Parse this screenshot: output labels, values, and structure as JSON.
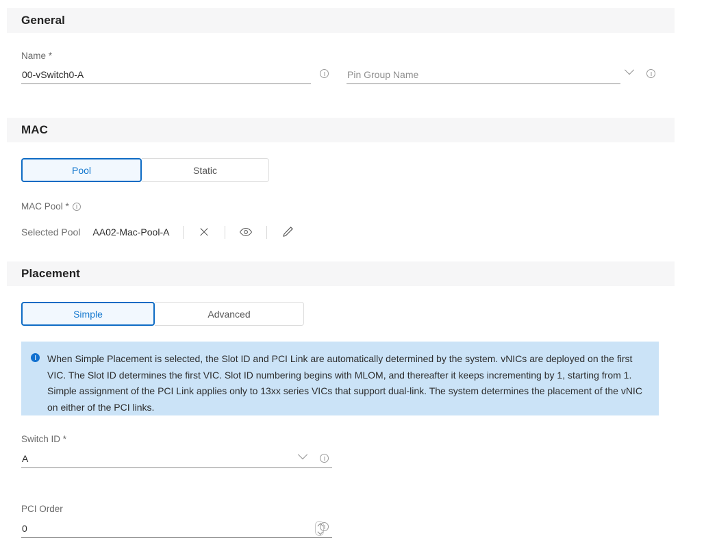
{
  "sections": {
    "general": {
      "title": "General"
    },
    "mac": {
      "title": "MAC"
    },
    "placement": {
      "title": "Placement"
    }
  },
  "general": {
    "name_label": "Name *",
    "name_value": "00-vSwitch0-A",
    "pin_group_placeholder": "Pin Group Name"
  },
  "mac": {
    "toggle": [
      {
        "label": "Pool",
        "active": true
      },
      {
        "label": "Static",
        "active": false
      }
    ],
    "pool_label": "MAC Pool *",
    "selected_label": "Selected Pool",
    "selected_value": "AA02-Mac-Pool-A"
  },
  "placement": {
    "toggle": [
      {
        "label": "Simple",
        "active": true
      },
      {
        "label": "Advanced",
        "active": false
      }
    ],
    "banner_text": "When Simple Placement is selected, the Slot ID and PCI Link are automatically determined by the system. vNICs are deployed on the first VIC. The Slot ID determines the first VIC. Slot ID numbering begins with MLOM, and thereafter it keeps incrementing by 1, starting from 1. Simple assignment of the PCI Link applies only to 13xx series VICs that support dual-link. The system determines the placement of the vNIC on either of the PCI links.",
    "switch_id_label": "Switch ID *",
    "switch_id_value": "A",
    "pci_order_label": "PCI Order",
    "pci_order_value": "0"
  },
  "colors": {
    "accent": "#1478cf",
    "accent_border": "#0d6bc4",
    "banner_bg": "#cbe3f7",
    "section_bg": "#f6f6f7"
  },
  "icons": {
    "info": "info-circle-icon",
    "chevron": "chevron-down-icon",
    "clear": "clear-x-icon",
    "view": "eye-icon",
    "edit": "pencil-icon",
    "stepper": "number-stepper-icon"
  }
}
